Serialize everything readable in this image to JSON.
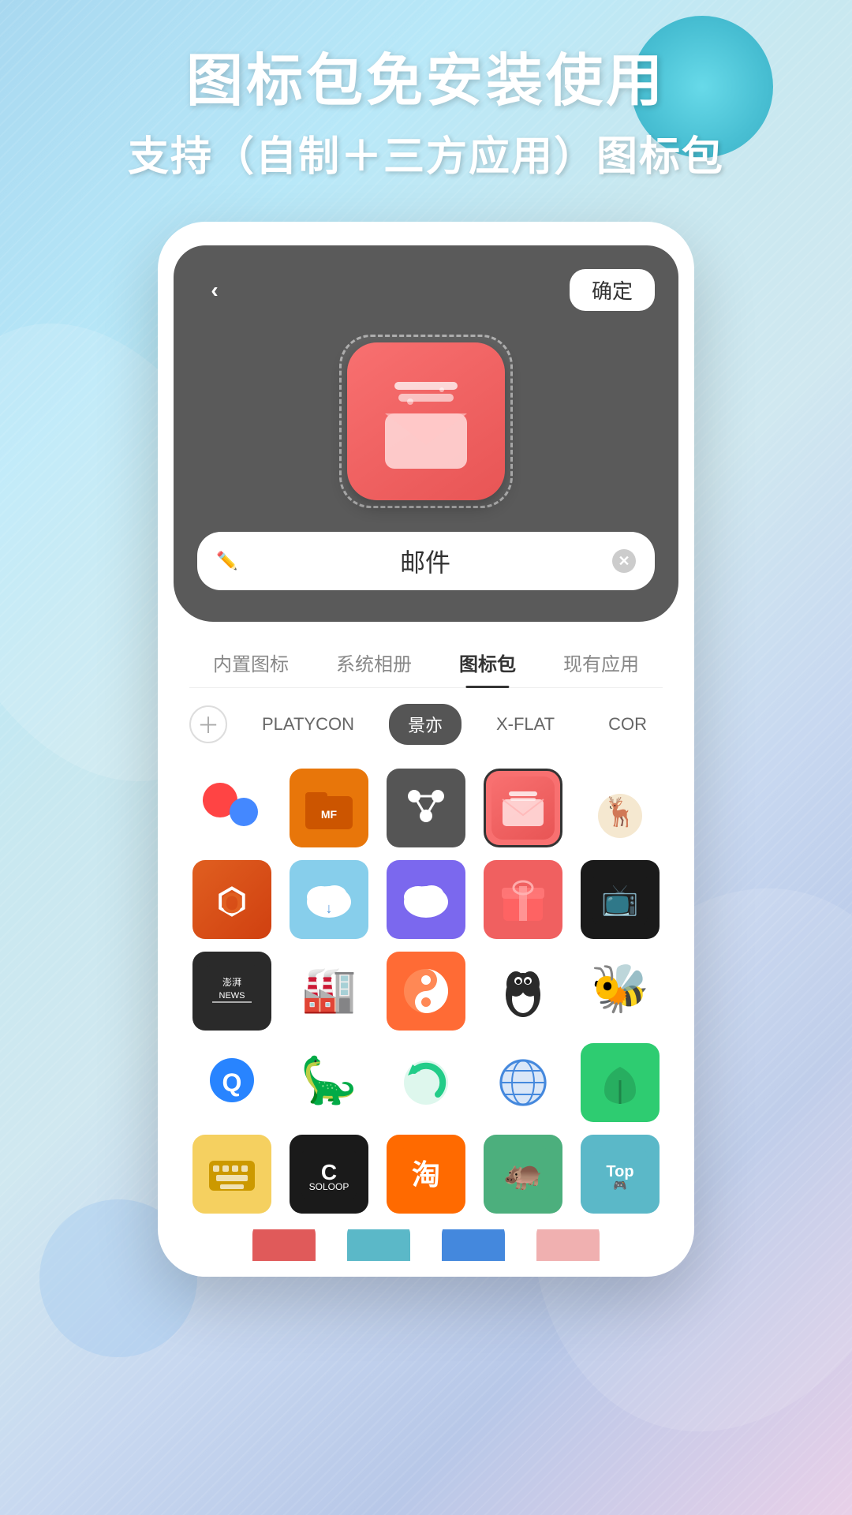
{
  "background": {
    "gradient_desc": "light blue to purple gradient"
  },
  "heading": {
    "title_main": "图标包免安装使用",
    "title_sub": "支持（自制＋三方应用）图标包"
  },
  "phone": {
    "nav": {
      "back_label": "‹",
      "confirm_label": "确定"
    },
    "app_name": "邮件",
    "tabs": [
      {
        "label": "内置图标",
        "active": false
      },
      {
        "label": "系统相册",
        "active": false
      },
      {
        "label": "图标包",
        "active": true
      },
      {
        "label": "现有应用",
        "active": false
      }
    ],
    "filters": [
      {
        "label": "＋",
        "type": "add"
      },
      {
        "label": "PLATYCON",
        "active": false
      },
      {
        "label": "景亦",
        "active": true
      },
      {
        "label": "X-FLAT",
        "active": false
      },
      {
        "label": "COR",
        "active": false
      }
    ],
    "icons": [
      {
        "id": "red-dots",
        "desc": "red dots abstract"
      },
      {
        "id": "orange-folder",
        "desc": "orange folder MF"
      },
      {
        "id": "dark-nodes",
        "desc": "dark network nodes"
      },
      {
        "id": "red-mail",
        "desc": "red mail selected",
        "selected": true
      },
      {
        "id": "moose",
        "desc": "moose animal"
      },
      {
        "id": "office",
        "desc": "Microsoft Office"
      },
      {
        "id": "cloud-blue",
        "desc": "blue cloud"
      },
      {
        "id": "cloud-purple",
        "desc": "purple cloud"
      },
      {
        "id": "red-gift",
        "desc": "red gift box"
      },
      {
        "id": "app-store-dark",
        "desc": "dark app store"
      },
      {
        "id": "news-dark",
        "desc": "news dark"
      },
      {
        "id": "factory",
        "desc": "factory building"
      },
      {
        "id": "taichi",
        "desc": "taichi ying yang"
      },
      {
        "id": "penguin",
        "desc": "penguin"
      },
      {
        "id": "gold-bee",
        "desc": "gold bee"
      },
      {
        "id": "blue-circle",
        "desc": "blue circle Q"
      },
      {
        "id": "dinosaur",
        "desc": "blue dinosaur"
      },
      {
        "id": "refresh",
        "desc": "green refresh"
      },
      {
        "id": "earth",
        "desc": "earth globe"
      },
      {
        "id": "leaf",
        "desc": "green leaf"
      },
      {
        "id": "keyboard",
        "desc": "yellow keyboard"
      },
      {
        "id": "c-black",
        "desc": "black C SOLOOP"
      },
      {
        "id": "taobao",
        "desc": "orange taobao"
      },
      {
        "id": "hippo",
        "desc": "green hippo"
      },
      {
        "id": "top",
        "desc": "teal TOP game"
      }
    ]
  }
}
